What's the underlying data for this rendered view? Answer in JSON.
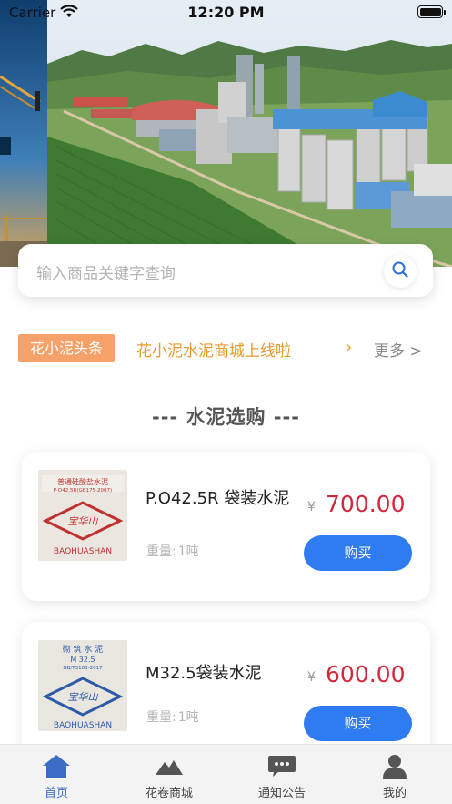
{
  "status_bar": {
    "carrier": "Carrier",
    "time": "12:20 PM"
  },
  "search": {
    "placeholder": "输入商品关键字查询",
    "icon": "search-icon"
  },
  "news": {
    "tag": "花小泥头条",
    "headline": "花小泥水泥商城上线啦",
    "arrow": "›",
    "more": "更多 >",
    "tag_color": "#f6a16a",
    "headline_color": "#e89a2a"
  },
  "section": {
    "title": "--- 水泥选购 ---"
  },
  "products": [
    {
      "name": "P.O42.5R 袋装水泥",
      "weight_label": "重量:",
      "weight_value": "1吨",
      "currency": "¥",
      "price": "700.00",
      "buy_label": "购买",
      "bag_text_top": "普通硅酸盐水泥",
      "bag_text_code": "P·O42.5R(GB175-2007)",
      "bag_brand_cn": "宝华山",
      "bag_brand_en": "BAOHUASHAN"
    },
    {
      "name": "M32.5袋装水泥",
      "weight_label": "重量:",
      "weight_value": "1吨",
      "currency": "¥",
      "price": "600.00",
      "buy_label": "购买",
      "bag_text_top": "砌 筑 水 泥",
      "bag_text_code": "M 32.5",
      "bag_text_std": "GB/T3183-2017",
      "bag_brand_cn": "宝华山",
      "bag_brand_en": "BAOHUASHAN"
    }
  ],
  "tabs": [
    {
      "label": "首页",
      "icon": "home-icon",
      "active": true
    },
    {
      "label": "花卷商城",
      "icon": "mountain-icon",
      "active": false
    },
    {
      "label": "通知公告",
      "icon": "message-icon",
      "active": false
    },
    {
      "label": "我的",
      "icon": "user-icon",
      "active": false
    }
  ],
  "colors": {
    "accent": "#2f7bf2",
    "price": "#d2283e",
    "tab_active": "#3b6cc6"
  }
}
